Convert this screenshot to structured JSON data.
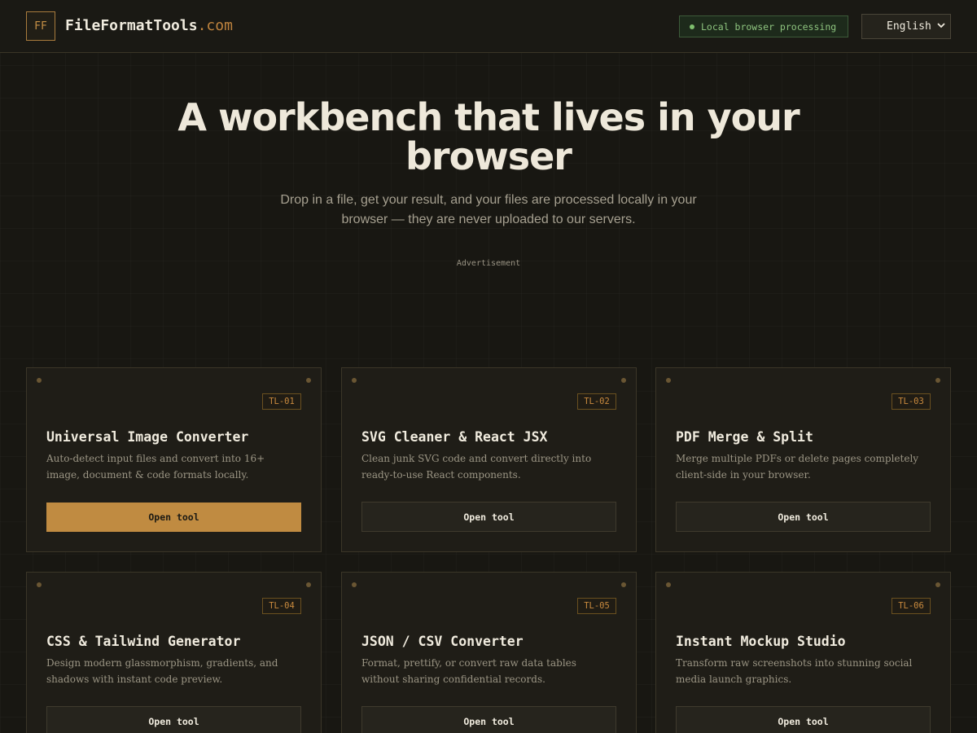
{
  "header": {
    "logo_initials": "FF",
    "brand_name": "FileFormatTools",
    "brand_domain": ".com",
    "status_badge": "Local browser processing",
    "language": "English"
  },
  "hero": {
    "title": "A workbench that lives in your browser",
    "subtitle": "Drop in a file, get your result, and your files are processed locally in your browser — they are never uploaded to our servers."
  },
  "advertisement_label": "Advertisement",
  "tools": [
    {
      "id": "TL-01",
      "title": "Universal Image Converter",
      "description": "Auto-detect input files and convert into 16+ image, document & code formats locally.",
      "button": "Open tool"
    },
    {
      "id": "TL-02",
      "title": "SVG Cleaner & React JSX",
      "description": "Clean junk SVG code and convert directly into ready-to-use React components.",
      "button": "Open tool"
    },
    {
      "id": "TL-03",
      "title": "PDF Merge & Split",
      "description": "Merge multiple PDFs or delete pages completely client-side in your browser.",
      "button": "Open tool"
    },
    {
      "id": "TL-04",
      "title": "CSS & Tailwind Generator",
      "description": "Design modern glassmorphism, gradients, and shadows with instant code preview.",
      "button": "Open tool"
    },
    {
      "id": "TL-05",
      "title": "JSON / CSV Converter",
      "description": "Format, prettify, or convert raw data tables without sharing confidential records.",
      "button": "Open tool"
    },
    {
      "id": "TL-06",
      "title": "Instant Mockup Studio",
      "description": "Transform raw screenshots into stunning social media launch graphics.",
      "button": "Open tool"
    }
  ],
  "colors": {
    "background": "#181712",
    "accent": "#c08b41",
    "status_green": "#7fbf6e",
    "card_background": "#1f1d17"
  }
}
